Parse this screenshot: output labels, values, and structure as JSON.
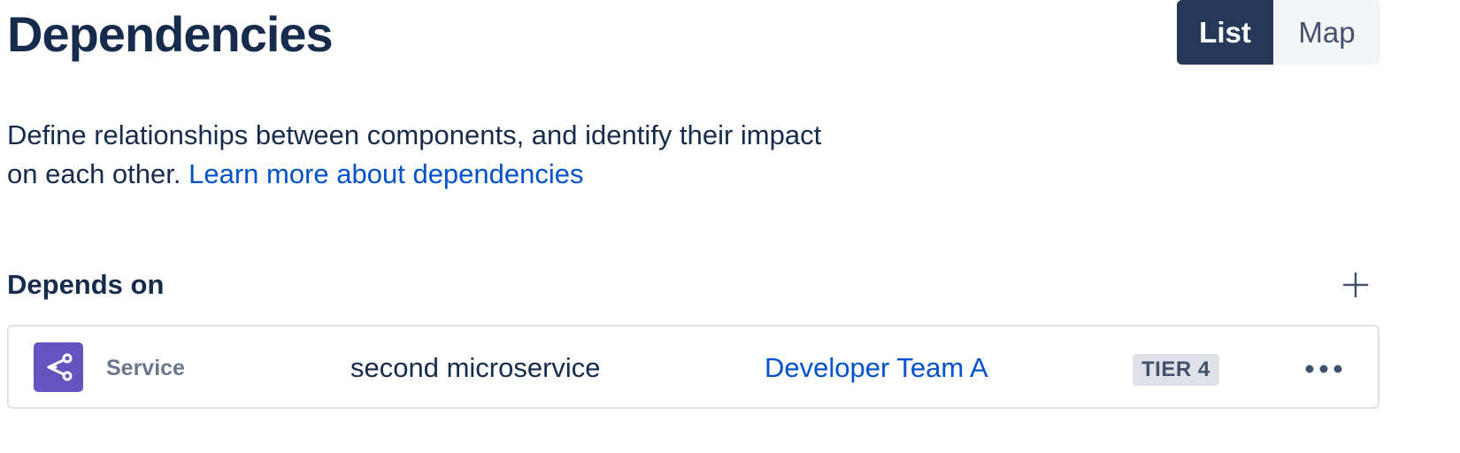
{
  "header": {
    "title": "Dependencies",
    "view_toggle": {
      "list_label": "List",
      "map_label": "Map",
      "selected": "List"
    }
  },
  "description": {
    "text": "Define relationships between components, and identify their impact on each other.",
    "link_label": "Learn more about dependencies"
  },
  "depends_on": {
    "title": "Depends on",
    "add_icon": "plus-icon",
    "items": [
      {
        "icon": "service-icon",
        "type": "Service",
        "name": "second microservice",
        "owner": "Developer Team A",
        "tier": "TIER 4",
        "menu_icon": "more-icon"
      }
    ]
  },
  "colors": {
    "primary_text": "#172b4d",
    "link": "#0052cc",
    "toggle_selected_bg": "#253858",
    "toggle_unselected_bg": "#f4f5f7",
    "service_icon_bg": "#6554c0",
    "tier_badge_bg": "#dfe1e6",
    "border": "#dfe1e6"
  }
}
